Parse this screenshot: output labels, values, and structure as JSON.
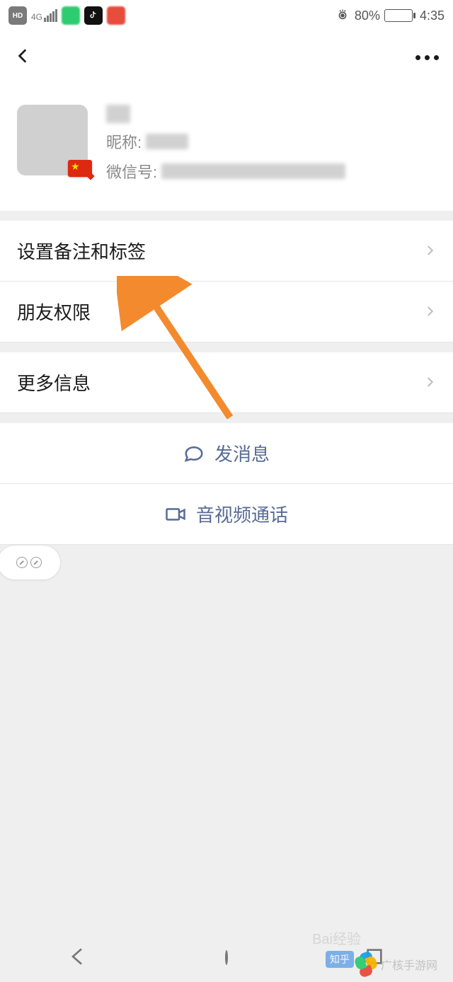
{
  "statusbar": {
    "hd": "HD",
    "network": "4G",
    "battery_pct": "80%",
    "battery_fill": 80,
    "time": "4:35"
  },
  "profile": {
    "nickname_label": "昵称:",
    "wechat_label": "微信号:"
  },
  "menu": {
    "remark": "设置备注和标签",
    "permission": "朋友权限",
    "more": "更多信息"
  },
  "actions": {
    "message": "发消息",
    "call": "音视频通话"
  },
  "watermarks": {
    "baidu": "Bai经验",
    "zhihu": "知乎",
    "logo": "广核手游网"
  }
}
